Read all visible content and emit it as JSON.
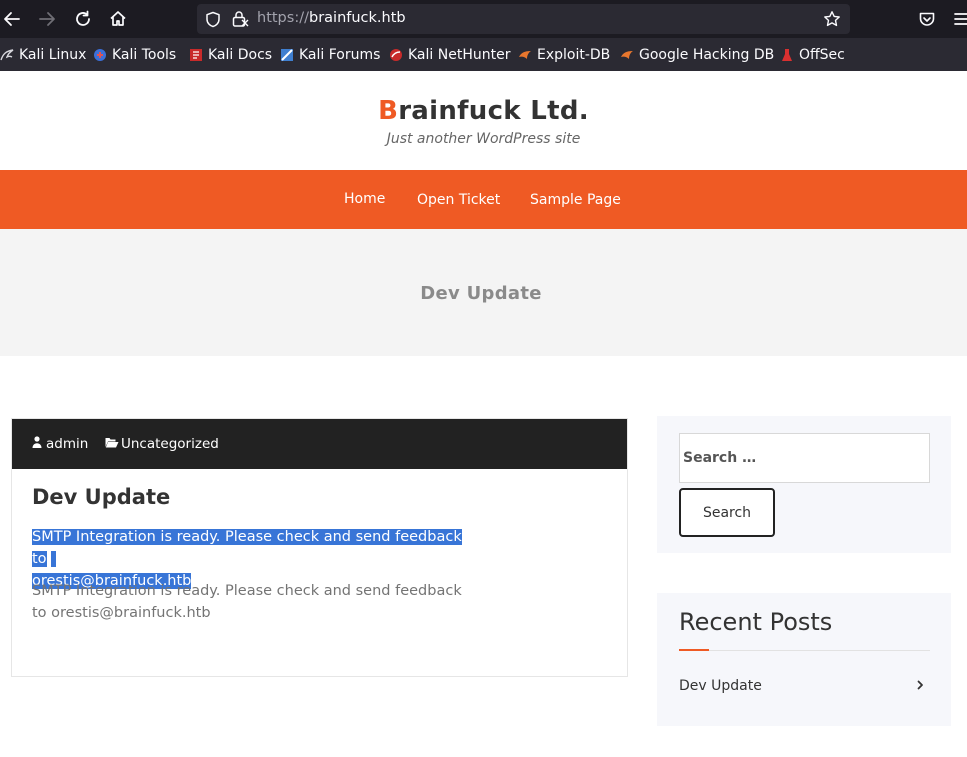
{
  "browser": {
    "url_scheme": "https://",
    "url_host": "brainfuck.htb",
    "bookmarks": [
      {
        "label": "Kali Linux",
        "icon": "kali-dragon-icon",
        "color": "#6fa8dc"
      },
      {
        "label": "Kali Tools",
        "icon": "kali-tools-icon",
        "color": "#e05252"
      },
      {
        "label": "Kali Docs",
        "icon": "kali-docs-icon",
        "color": "#d93030"
      },
      {
        "label": "Kali Forums",
        "icon": "kali-forums-icon",
        "color": "#5b9bd5"
      },
      {
        "label": "Kali NetHunter",
        "icon": "kali-nethunter-icon",
        "color": "#d93030"
      },
      {
        "label": "Exploit-DB",
        "icon": "exploit-db-icon",
        "color": "#e8772e"
      },
      {
        "label": "Google Hacking DB",
        "icon": "ghdb-icon",
        "color": "#e8772e"
      },
      {
        "label": "OffSec",
        "icon": "offsec-icon",
        "color": "#d93030"
      }
    ]
  },
  "site": {
    "title_first": "B",
    "title_rest": "rainfuck Ltd.",
    "tagline": "Just another WordPress site",
    "accent_color": "#ef5a24",
    "menu": [
      {
        "label": "Home"
      },
      {
        "label": "Open Ticket"
      },
      {
        "label": "Sample Page"
      }
    ]
  },
  "page_header": {
    "title": "Dev Update"
  },
  "post": {
    "author": "admin",
    "category": "Uncategorized",
    "title": "Dev Update",
    "selected_text_line1": "SMTP Integration is ready. Please check and send feedback to",
    "selected_text_line2": "orestis@brainfuck.htb",
    "body": "SMTP Integration is ready. Please check and send feedback to orestis@brainfuck.htb"
  },
  "sidebar": {
    "search_placeholder": "Search …",
    "search_button": "Search",
    "recent_title": "Recent Posts",
    "recent_posts": [
      {
        "label": "Dev Update"
      }
    ]
  }
}
